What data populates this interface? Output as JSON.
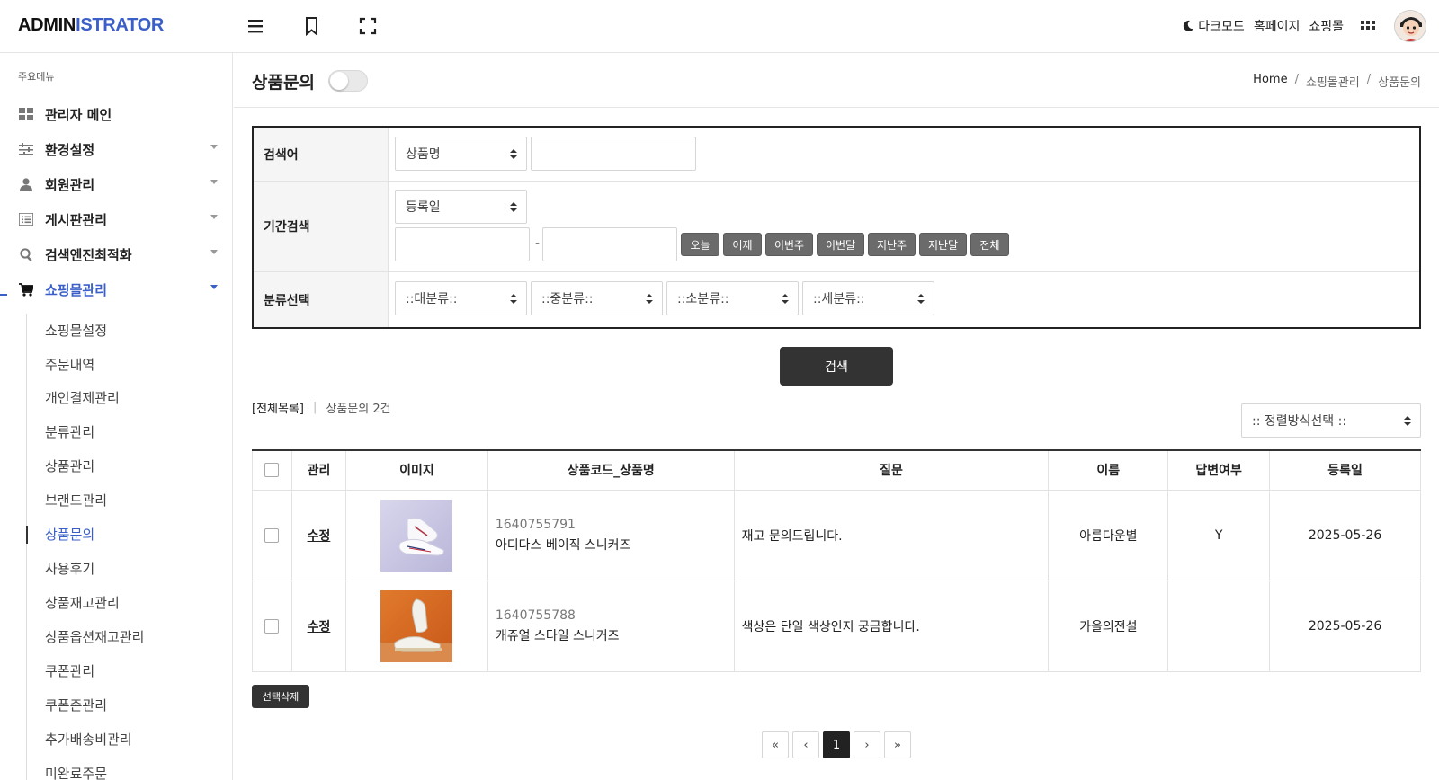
{
  "header": {
    "logo_part1": "ADMIN",
    "logo_part2": "ISTRATOR",
    "dark_mode": "다크모드",
    "homepage": "홈페이지",
    "shop": "쇼핑몰",
    "icons": [
      "hamburger-icon",
      "bookmark-icon",
      "fullscreen-icon",
      "moon-icon",
      "apps-grid-icon"
    ]
  },
  "sidebar": {
    "heading": "주요메뉴",
    "items": [
      {
        "label": "관리자 메인",
        "icon": "dashboard-icon"
      },
      {
        "label": "환경설정",
        "icon": "sliders-icon"
      },
      {
        "label": "회원관리",
        "icon": "user-icon"
      },
      {
        "label": "게시판관리",
        "icon": "list-icon"
      },
      {
        "label": "검색엔진최적화",
        "icon": "search-icon"
      },
      {
        "label": "쇼핑몰관리",
        "icon": "cart-icon"
      }
    ],
    "sub_items": [
      "쇼핑몰설정",
      "주문내역",
      "개인결제관리",
      "분류관리",
      "상품관리",
      "브랜드관리",
      "상품문의",
      "사용후기",
      "상품재고관리",
      "상품옵션재고관리",
      "쿠폰관리",
      "쿠폰존관리",
      "추가배송비관리",
      "미완료주문"
    ]
  },
  "page": {
    "title": "상품문의",
    "breadcrumb": [
      "Home",
      "쇼핑몰관리",
      "상품문의"
    ]
  },
  "search": {
    "keyword_label": "검색어",
    "keyword_select": "상품명",
    "keyword_value": "",
    "period_label": "기간검색",
    "period_select": "등록일",
    "date_from": "",
    "date_to": "",
    "date_sep": "-",
    "period_buttons": [
      "오늘",
      "어제",
      "이번주",
      "이번달",
      "지난주",
      "지난달",
      "전체"
    ],
    "category_label": "분류선택",
    "category_selects": [
      "::대분류::",
      "::중분류::",
      "::소분류::",
      "::세분류::"
    ],
    "submit": "검색"
  },
  "list": {
    "all_label": "[전체목록]",
    "count_label": "상품문의 2건",
    "sort_select": ":: 정렬방식선택 ::"
  },
  "table": {
    "columns": [
      "",
      "관리",
      "이미지",
      "상품코드_상품명",
      "질문",
      "이름",
      "답변여부",
      "등록일"
    ],
    "rows": [
      {
        "edit": "수정",
        "code": "1640755791",
        "name": "아디다스 베이직 스니커즈",
        "question": "재고 문의드립니다.",
        "author": "아름다운별",
        "answered": "Y",
        "date": "2025-05-26"
      },
      {
        "edit": "수정",
        "code": "1640755788",
        "name": "캐쥬얼 스타일 스니커즈",
        "question": "색상은 단일 색상인지 궁금합니다.",
        "author": "가을의전설",
        "answered": "",
        "date": "2025-05-26"
      }
    ]
  },
  "actions": {
    "delete_selected": "선택삭제"
  },
  "pagination": {
    "first": "«",
    "prev": "‹",
    "current": "1",
    "next": "›",
    "last": "»"
  },
  "colors": {
    "accent": "#3a5fc8",
    "dark": "#333333",
    "period_button": "#6b6b6b"
  }
}
